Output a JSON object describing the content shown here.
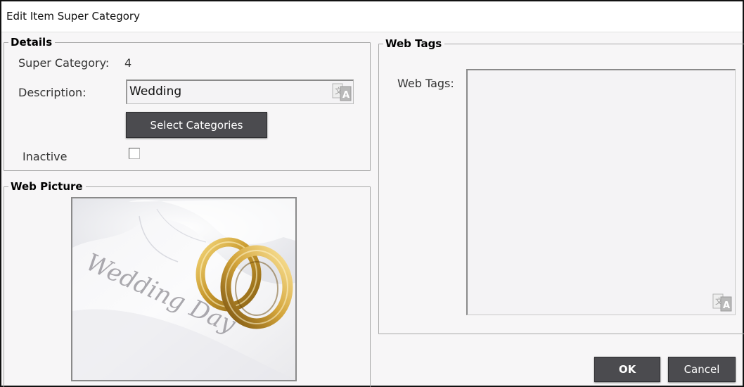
{
  "dialog": {
    "title": "Edit Item Super Category"
  },
  "details": {
    "legend": "Details",
    "super_category_label": "Super Category:",
    "super_category_value": "4",
    "description_label": "Description:",
    "description_value": "Wedding",
    "select_categories_label": "Select Categories",
    "inactive_label": "Inactive",
    "inactive_checked": false
  },
  "web_picture": {
    "legend": "Web Picture",
    "image_text": "Wedding Day"
  },
  "web_tags": {
    "legend": "Web Tags",
    "label": "Web Tags:",
    "value": ""
  },
  "footer": {
    "ok_label": "OK",
    "cancel_label": "Cancel"
  },
  "icons": {
    "translate": "translate-icon"
  }
}
